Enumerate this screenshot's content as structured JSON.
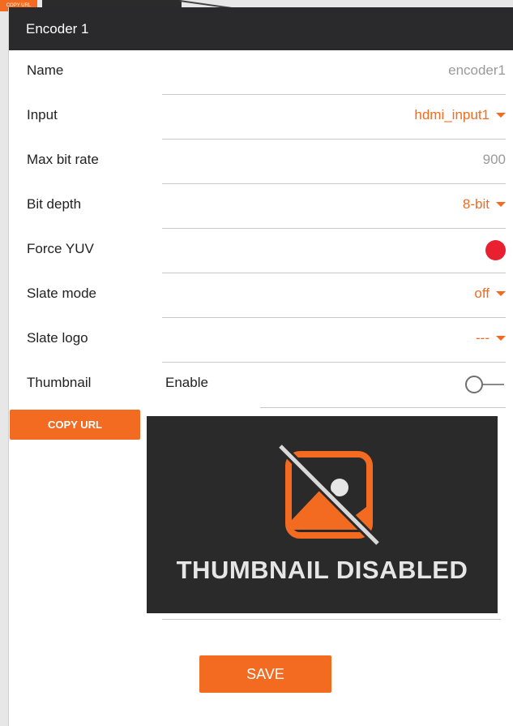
{
  "background": {
    "copy_url_label": "COPY URL"
  },
  "dialog": {
    "title": "Encoder 1"
  },
  "fields": {
    "name": {
      "label": "Name",
      "value": "encoder1"
    },
    "input": {
      "label": "Input",
      "value": "hdmi_input1"
    },
    "max_bit_rate": {
      "label": "Max bit rate",
      "value": "900"
    },
    "bit_depth": {
      "label": "Bit depth",
      "value": "8-bit"
    },
    "force_yuv": {
      "label": "Force YUV",
      "enabled": true
    },
    "slate_mode": {
      "label": "Slate mode",
      "value": "off"
    },
    "slate_logo": {
      "label": "Slate logo",
      "value": "---"
    },
    "thumbnail": {
      "label": "Thumbnail",
      "enable_label": "Enable",
      "enabled": false
    }
  },
  "thumbnail_preview": {
    "copy_url_label": "COPY URL",
    "message": "THUMBNAIL DISABLED",
    "icon": "image-disabled-icon"
  },
  "actions": {
    "save_label": "SAVE"
  },
  "colors": {
    "accent": "#f26b21",
    "header": "#2a2a2c",
    "force_yuv_dot": "#e8202f",
    "thumb_bg": "#2a2a2a"
  }
}
